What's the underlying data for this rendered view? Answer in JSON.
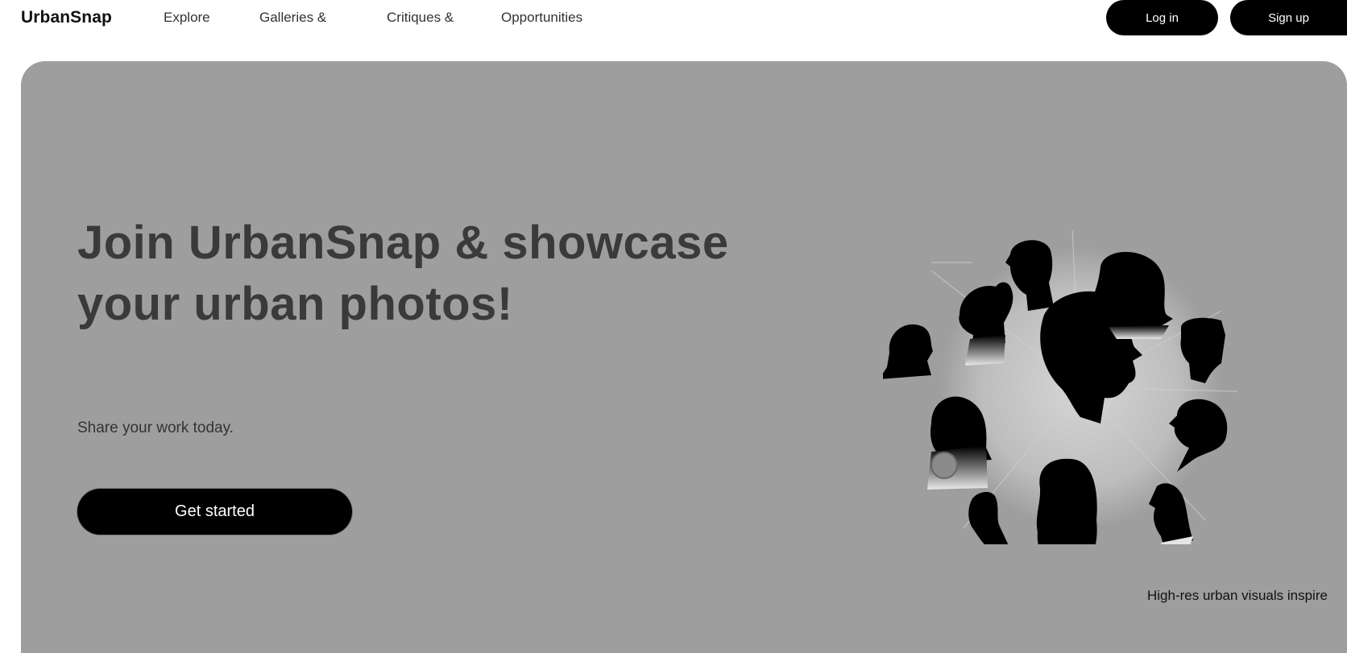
{
  "nav": {
    "brand": "UrbanSnap",
    "links": [
      "Explore",
      "Galleries &",
      "Critiques &",
      "Opportunities"
    ],
    "login_label": "Log in",
    "signup_label": "Sign up"
  },
  "hero": {
    "title": "Join UrbanSnap & showcase your urban photos!",
    "subtitle": "Share your work today.",
    "cta_label": "Get started",
    "illustration_icon": "people-silhouettes-collage-icon",
    "caption": "High-res urban visuals inspire"
  },
  "colors": {
    "hero_background": "#9e9e9e",
    "button_background": "#000000",
    "button_text": "#ffffff",
    "title_text": "#3a3a3a"
  }
}
